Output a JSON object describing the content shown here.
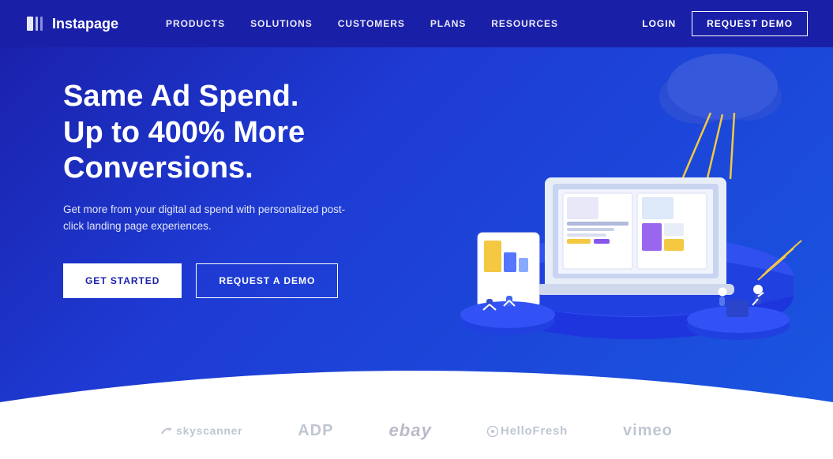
{
  "navbar": {
    "logo_text": "Instapage",
    "nav_links": [
      {
        "label": "PRODUCTS",
        "id": "products"
      },
      {
        "label": "SOLUTIONS",
        "id": "solutions"
      },
      {
        "label": "CUSTOMERS",
        "id": "customers"
      },
      {
        "label": "PLANS",
        "id": "plans"
      },
      {
        "label": "RESOURCES",
        "id": "resources"
      }
    ],
    "login_label": "LOGIN",
    "request_demo_label": "REQUEST DEMO"
  },
  "hero": {
    "title_line1": "Same Ad Spend.",
    "title_line2": "Up to 400% More Conversions.",
    "subtitle": "Get more from your digital ad spend with personalized post-click landing page experiences.",
    "btn_get_started": "GET STARTED",
    "btn_request_demo": "REQUEST A DEMO"
  },
  "logos": [
    {
      "id": "skyscanner",
      "text": "✈ skyscanner"
    },
    {
      "id": "adp",
      "text": "ADP"
    },
    {
      "id": "ebay",
      "text": "ebay"
    },
    {
      "id": "hellofresh",
      "text": "⊕ HelloFresh"
    },
    {
      "id": "vimeo",
      "text": "vimeo"
    }
  ]
}
